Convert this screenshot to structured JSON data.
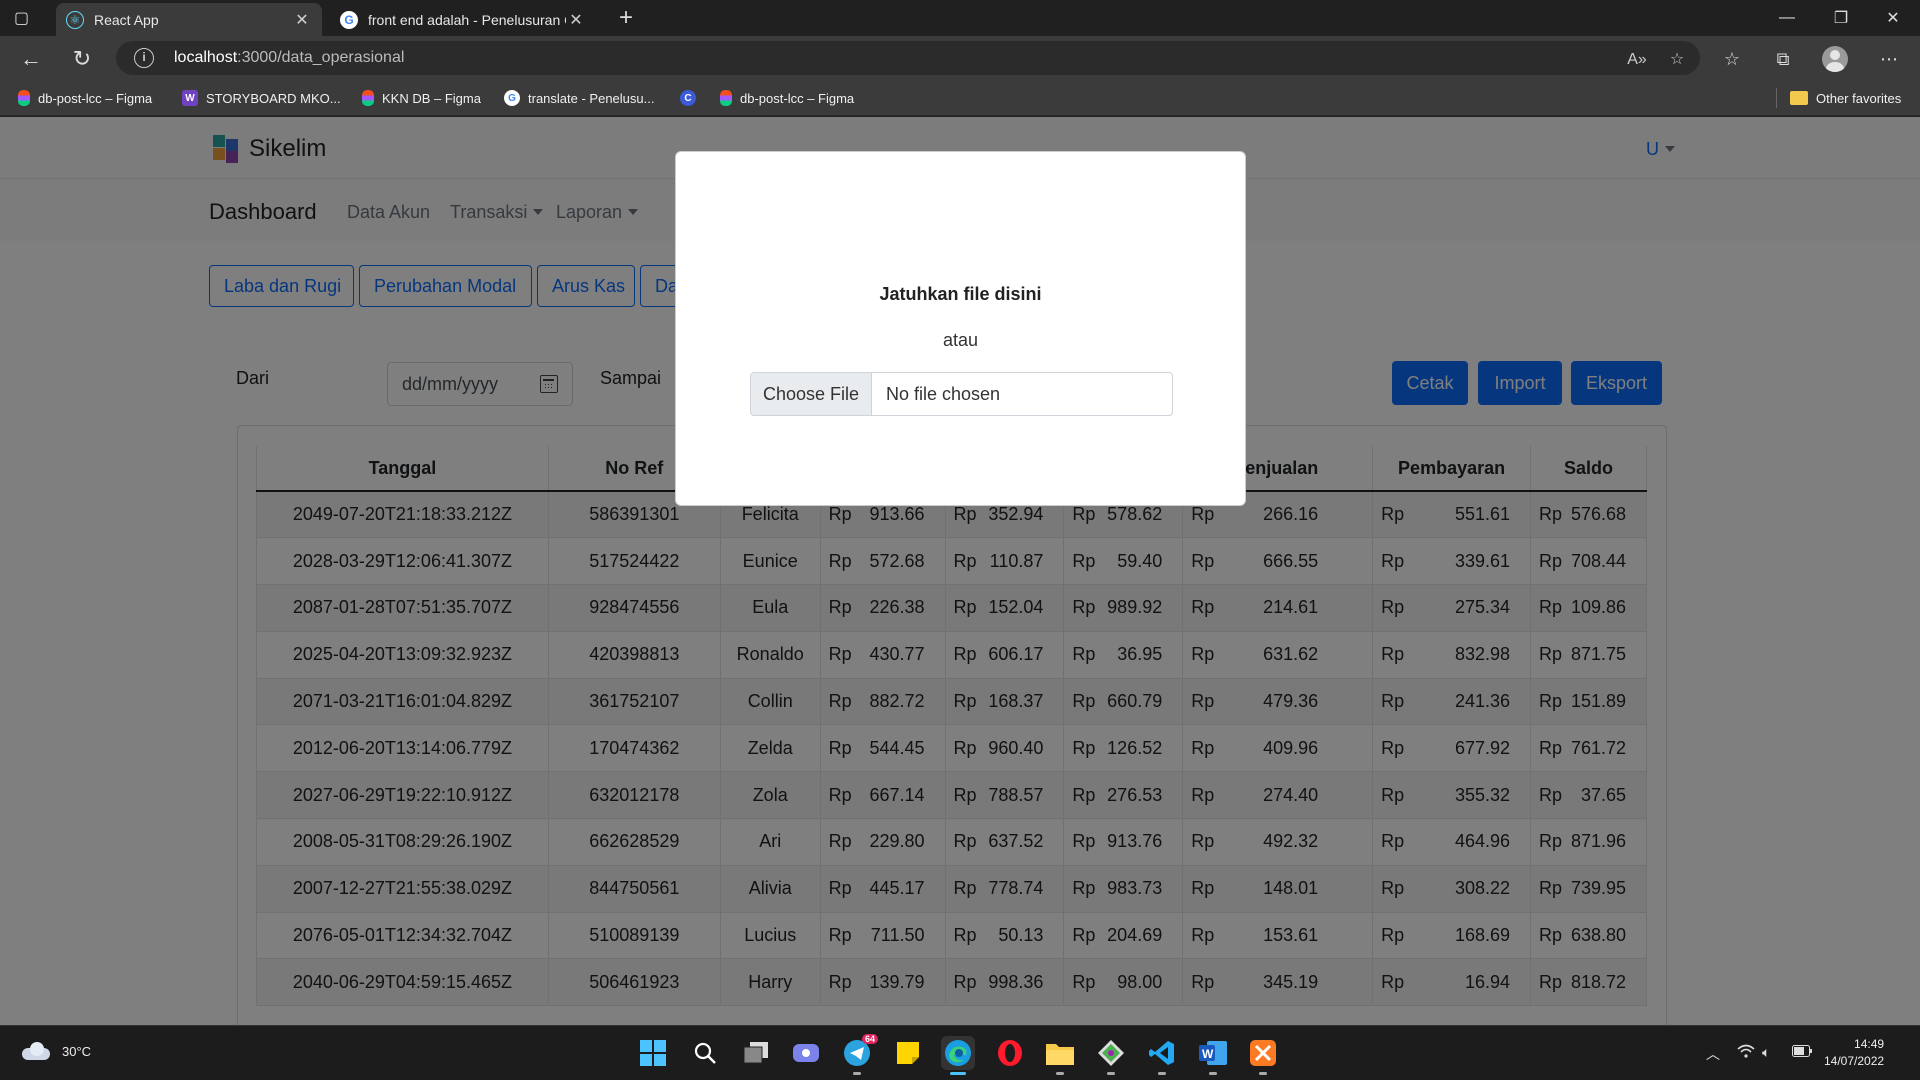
{
  "browser": {
    "tabs": [
      {
        "title": "React App",
        "icon": "react-icon",
        "active": true
      },
      {
        "title": "front end adalah - Penelusuran Google",
        "icon": "google-icon",
        "active": false
      }
    ],
    "address": {
      "host": "localhost",
      "path": ":3000/data_operasional"
    },
    "bookmarks": [
      {
        "label": "db-post-lcc – Figma",
        "icon": "figma-icon"
      },
      {
        "label": "STORYBOARD MKO...",
        "icon": "w-icon"
      },
      {
        "label": "KKN DB – Figma",
        "icon": "figma-icon"
      },
      {
        "label": "translate - Penelusu...",
        "icon": "google-icon"
      },
      {
        "label": "",
        "icon": "c-icon"
      },
      {
        "label": "db-post-lcc – Figma",
        "icon": "figma-icon"
      }
    ],
    "other_favorites": "Other favorites"
  },
  "app": {
    "brand": "Sikelim",
    "user_menu": "U",
    "nav": {
      "dashboard": "Dashboard",
      "data_akun": "Data Akun",
      "transaksi": "Transaksi",
      "laporan": "Laporan"
    },
    "report_buttons": [
      "Laba dan Rugi",
      "Perubahan Modal",
      "Arus Kas",
      "Da"
    ],
    "filter": {
      "from_label": "Dari",
      "to_label": "Sampai",
      "date_placeholder": "dd/mm/yyyy"
    },
    "actions": {
      "print": "Cetak",
      "import": "Import",
      "export": "Eksport"
    },
    "table": {
      "headers": [
        "Tanggal",
        "No Ref",
        "",
        "",
        "",
        "",
        "l Penjualan",
        "Pembayaran",
        "Saldo"
      ],
      "currency": "Rp",
      "rows": [
        [
          "2049-07-20T21:18:33.212Z",
          "586391301",
          "Felicita",
          "913.66",
          "352.94",
          "578.62",
          "266.16",
          "551.61",
          "576.68"
        ],
        [
          "2028-03-29T12:06:41.307Z",
          "517524422",
          "Eunice",
          "572.68",
          "110.87",
          "59.40",
          "666.55",
          "339.61",
          "708.44"
        ],
        [
          "2087-01-28T07:51:35.707Z",
          "928474556",
          "Eula",
          "226.38",
          "152.04",
          "989.92",
          "214.61",
          "275.34",
          "109.86"
        ],
        [
          "2025-04-20T13:09:32.923Z",
          "420398813",
          "Ronaldo",
          "430.77",
          "606.17",
          "36.95",
          "631.62",
          "832.98",
          "871.75"
        ],
        [
          "2071-03-21T16:01:04.829Z",
          "361752107",
          "Collin",
          "882.72",
          "168.37",
          "660.79",
          "479.36",
          "241.36",
          "151.89"
        ],
        [
          "2012-06-20T13:14:06.779Z",
          "170474362",
          "Zelda",
          "544.45",
          "960.40",
          "126.52",
          "409.96",
          "677.92",
          "761.72"
        ],
        [
          "2027-06-29T19:22:10.912Z",
          "632012178",
          "Zola",
          "667.14",
          "788.57",
          "276.53",
          "274.40",
          "355.32",
          "37.65"
        ],
        [
          "2008-05-31T08:29:26.190Z",
          "662628529",
          "Ari",
          "229.80",
          "637.52",
          "913.76",
          "492.32",
          "464.96",
          "871.96"
        ],
        [
          "2007-12-27T21:55:38.029Z",
          "844750561",
          "Alivia",
          "445.17",
          "778.74",
          "983.73",
          "148.01",
          "308.22",
          "739.95"
        ],
        [
          "2076-05-01T12:34:32.704Z",
          "510089139",
          "Lucius",
          "711.50",
          "50.13",
          "204.69",
          "153.61",
          "168.69",
          "638.80"
        ],
        [
          "2040-06-29T04:59:15.465Z",
          "506461923",
          "Harry",
          "139.79",
          "998.36",
          "98.00",
          "345.19",
          "16.94",
          "818.72"
        ]
      ]
    }
  },
  "modal": {
    "title": "Jatuhkan file disini",
    "or_text": "atau",
    "file_button": "Choose File",
    "file_status": "No file chosen"
  },
  "taskbar": {
    "weather": "30°C",
    "time": "14:49",
    "date": "14/07/2022",
    "telegram_badge": "64"
  },
  "colors": {
    "primary": "#0d6efd",
    "backdrop": "rgba(0,0,0,0.5)"
  }
}
